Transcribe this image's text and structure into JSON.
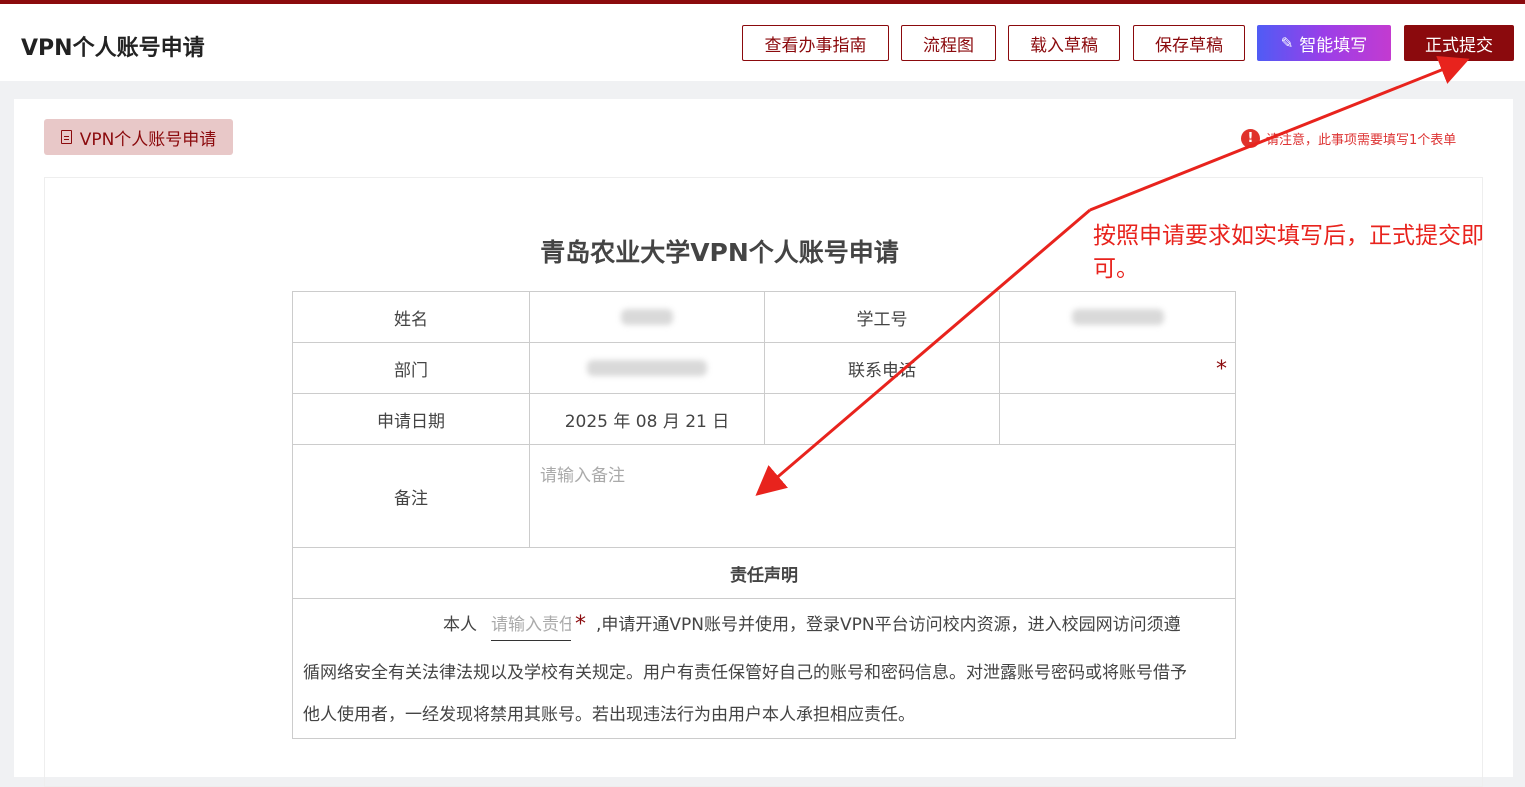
{
  "header": {
    "title": "VPN个人账号申请",
    "buttons": {
      "guide": "查看办事指南",
      "flow": "流程图",
      "load_draft": "载入草稿",
      "save_draft": "保存草稿",
      "smart_fill": "智能填写",
      "submit": "正式提交"
    }
  },
  "tag": {
    "label": "VPN个人账号申请"
  },
  "notice": "请注意，此事项需要填写1个表单",
  "form": {
    "title": "青岛农业大学VPN个人账号申请",
    "labels": {
      "name": "姓名",
      "id": "学工号",
      "dept": "部门",
      "phone": "联系电话",
      "date": "申请日期",
      "note": "备注"
    },
    "values": {
      "date": "2025 年 08 月 21 日"
    },
    "note_placeholder": "请输入备注",
    "declaration": {
      "heading": "责任声明",
      "prefix": "本人",
      "input_placeholder": "请输入责任人",
      "line1": ",申请开通VPN账号并使用，登录VPN平台访问校内资源，进入校园网访问须遵",
      "line2": "循网络安全有关法律法规以及学校有关规定。用户有责任保管好自己的账号和密码信息。对泄露账号密码或将账号借予",
      "line3": "他人使用者，一经发现将禁用其账号。若出现违法行为由用户本人承担相应责任。"
    }
  },
  "annotation": "按照申请要求如实填写后，正式提交即可。",
  "colors": {
    "brand": "#8b0a0d",
    "annotation": "#e8231d",
    "tag_bg": "#e8c8c8"
  },
  "icons": {
    "tag": "document-icon",
    "notice": "warning-icon",
    "smart_fill": "magic-wand-icon"
  }
}
